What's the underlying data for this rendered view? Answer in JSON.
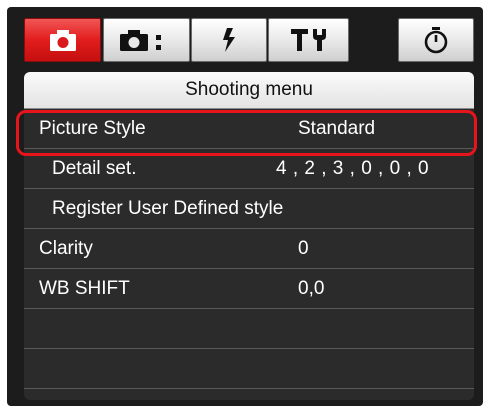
{
  "tabs": [
    {
      "name": "shooting",
      "icon": "camera-icon",
      "active": true
    },
    {
      "name": "shooting-2",
      "icon": "camera-sub-icon",
      "active": false
    },
    {
      "name": "flash",
      "icon": "flash-icon",
      "active": false
    },
    {
      "name": "tools",
      "icon": "tools-icon",
      "active": false
    },
    {
      "name": "timer",
      "icon": "timer-icon",
      "active": false
    }
  ],
  "menu": {
    "title": "Shooting menu",
    "rows": [
      {
        "label": "Picture Style",
        "value": "Standard",
        "selected": true
      },
      {
        "label": "Detail set.",
        "value": "4 , 2 , 3 , 0 , 0 , 0"
      },
      {
        "label": "Register User Defined style",
        "value": ""
      },
      {
        "label": "Clarity",
        "value": "0"
      },
      {
        "label": "WB SHIFT",
        "value": "0,0"
      }
    ]
  },
  "colors": {
    "active_tab": "#e21d1d",
    "highlight": "#e8141c",
    "panel_bg": "#2b2b2b"
  }
}
